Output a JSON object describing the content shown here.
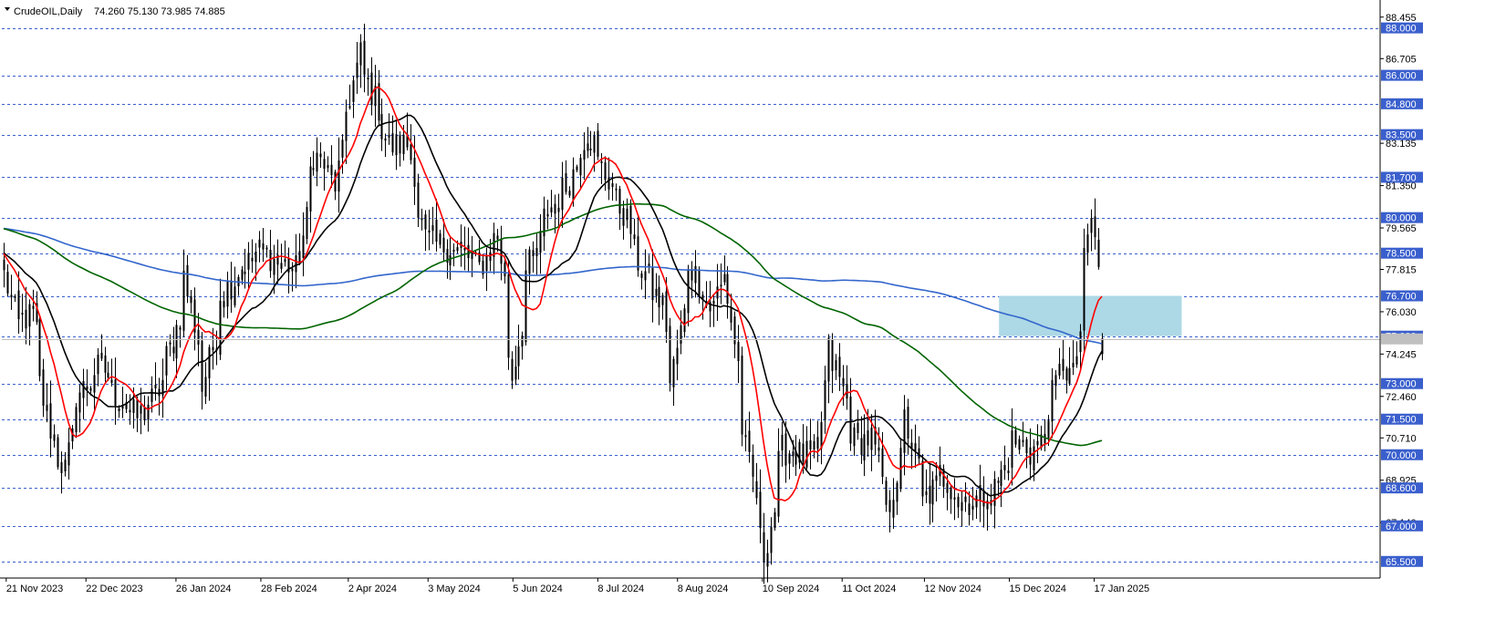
{
  "header": {
    "symbol": "CrudeOIL,Daily",
    "ohlc": "74.260 75.130 73.985 74.885"
  },
  "chart_data": {
    "type": "candlestick",
    "title": "CrudeOIL,Daily",
    "ylim": [
      64.8,
      89.1
    ],
    "xlim": [
      "2023-11-20",
      "2025-01-20"
    ],
    "last_ohlc": {
      "open": 74.26,
      "high": 75.13,
      "low": 73.985,
      "close": 74.885
    },
    "grid": false,
    "y_axis_labels": [
      "88.455",
      "86.705",
      "83.135",
      "81.350",
      "79.565",
      "77.815",
      "76.030",
      "74.245",
      "72.460",
      "70.710",
      "68.925",
      "67.140"
    ],
    "x_tick_labels": [
      "21 Nov 2023",
      "22 Dec 2023",
      "26 Jan 2024",
      "28 Feb 2024",
      "2 Apr 2024",
      "3 May 2024",
      "5 Jun 2024",
      "8 Jul 2024",
      "8 Aug 2024",
      "10 Sep 2024",
      "11 Oct 2024",
      "12 Nov 2024",
      "15 Dec 2024",
      "17 Jan 2025"
    ],
    "levels": [
      "88.000",
      "86.000",
      "84.800",
      "83.500",
      "81.700",
      "80.000",
      "78.500",
      "76.700",
      "75.000",
      "73.000",
      "71.500",
      "70.000",
      "68.600",
      "67.000",
      "65.500"
    ],
    "current_price_line": 74.885,
    "zone": {
      "date_from": "2024-12-11",
      "date_to": "2025-02-20",
      "price_low": 75.0,
      "price_high": 76.7,
      "color": "#add8e6"
    },
    "colors": {
      "up_candle": "#ffffff",
      "down_candle": "#000000",
      "level_line": "#3a5fcd",
      "label_bg": "#3a5fcd",
      "ma_fast": "#ff0000",
      "ma_mid": "#000000",
      "ma_slow1": "#006400",
      "ma_slow2": "#3366cc"
    },
    "close_anchors": [
      [
        "2023-11-20",
        77.6
      ],
      [
        "2023-11-24",
        75.5
      ],
      [
        "2023-11-30",
        75.9
      ],
      [
        "2023-12-05",
        72.3
      ],
      [
        "2023-12-08",
        70.5
      ],
      [
        "2023-12-13",
        69.4
      ],
      [
        "2023-12-18",
        72.5
      ],
      [
        "2023-12-27",
        73.8
      ],
      [
        "2024-01-03",
        72.3
      ],
      [
        "2024-01-10",
        71.6
      ],
      [
        "2024-01-17",
        72.4
      ],
      [
        "2024-01-24",
        74.8
      ],
      [
        "2024-01-29",
        77.5
      ],
      [
        "2024-02-05",
        72.8
      ],
      [
        "2024-02-12",
        76.8
      ],
      [
        "2024-02-20",
        77.9
      ],
      [
        "2024-02-27",
        78.6
      ],
      [
        "2024-03-05",
        78.1
      ],
      [
        "2024-03-12",
        77.8
      ],
      [
        "2024-03-19",
        82.7
      ],
      [
        "2024-03-27",
        81.4
      ],
      [
        "2024-04-05",
        86.9
      ],
      [
        "2024-04-10",
        85.3
      ],
      [
        "2024-04-17",
        83.0
      ],
      [
        "2024-04-24",
        83.1
      ],
      [
        "2024-05-01",
        79.1
      ],
      [
        "2024-05-08",
        78.8
      ],
      [
        "2024-05-15",
        78.5
      ],
      [
        "2024-05-22",
        77.9
      ],
      [
        "2024-05-29",
        79.3
      ],
      [
        "2024-06-04",
        73.3
      ],
      [
        "2024-06-10",
        77.7
      ],
      [
        "2024-06-18",
        80.3
      ],
      [
        "2024-06-25",
        81.3
      ],
      [
        "2024-07-03",
        83.6
      ],
      [
        "2024-07-10",
        81.8
      ],
      [
        "2024-07-17",
        80.2
      ],
      [
        "2024-07-24",
        77.8
      ],
      [
        "2024-08-01",
        76.3
      ],
      [
        "2024-08-05",
        73.0
      ],
      [
        "2024-08-12",
        78.1
      ],
      [
        "2024-08-19",
        76.3
      ],
      [
        "2024-08-26",
        77.5
      ],
      [
        "2024-09-03",
        70.2
      ],
      [
        "2024-09-10",
        65.8
      ],
      [
        "2024-09-17",
        70.2
      ],
      [
        "2024-09-24",
        70.0
      ],
      [
        "2024-10-01",
        69.9
      ],
      [
        "2024-10-04",
        74.4
      ],
      [
        "2024-10-08",
        73.6
      ],
      [
        "2024-10-15",
        70.6
      ],
      [
        "2024-10-22",
        70.7
      ],
      [
        "2024-10-28",
        67.4
      ],
      [
        "2024-11-04",
        71.5
      ],
      [
        "2024-11-11",
        68.0
      ],
      [
        "2024-11-18",
        69.2
      ],
      [
        "2024-11-25",
        68.0
      ],
      [
        "2024-12-02",
        68.1
      ],
      [
        "2024-12-09",
        68.6
      ],
      [
        "2024-12-16",
        70.6
      ],
      [
        "2024-12-23",
        70.1
      ],
      [
        "2024-12-27",
        70.6
      ],
      [
        "2025-01-03",
        73.9
      ],
      [
        "2025-01-08",
        73.3
      ],
      [
        "2025-01-15",
        80.0
      ],
      [
        "2025-01-17",
        77.9
      ],
      [
        "2025-01-20",
        74.9
      ]
    ]
  }
}
